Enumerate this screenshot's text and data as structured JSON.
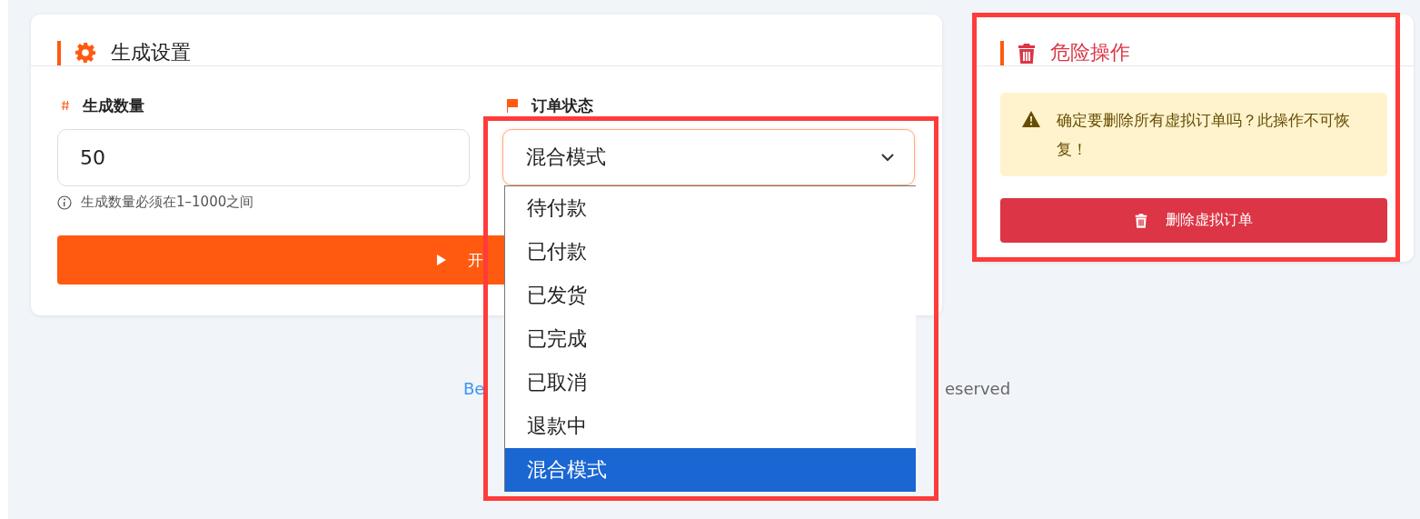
{
  "settings": {
    "title": "生成设置",
    "quantity": {
      "label": "生成数量",
      "value": "50",
      "hint": "生成数量必须在1–1000之间"
    },
    "status": {
      "label": "订单状态",
      "value": "混合模式",
      "expanded": true,
      "options": [
        {
          "label": "待付款",
          "selected": false
        },
        {
          "label": "已付款",
          "selected": false
        },
        {
          "label": "已发货",
          "selected": false
        },
        {
          "label": "已完成",
          "selected": false
        },
        {
          "label": "已取消",
          "selected": false
        },
        {
          "label": "退款中",
          "selected": false
        },
        {
          "label": "混合模式",
          "selected": true
        }
      ]
    },
    "start_button": "开"
  },
  "danger": {
    "title": "危险操作",
    "warning": "确定要删除所有虚拟订单吗？此操作不可恢复！",
    "delete_button": "删除虚拟订单"
  },
  "footer": {
    "left": "Be",
    "right": "eserved"
  }
}
